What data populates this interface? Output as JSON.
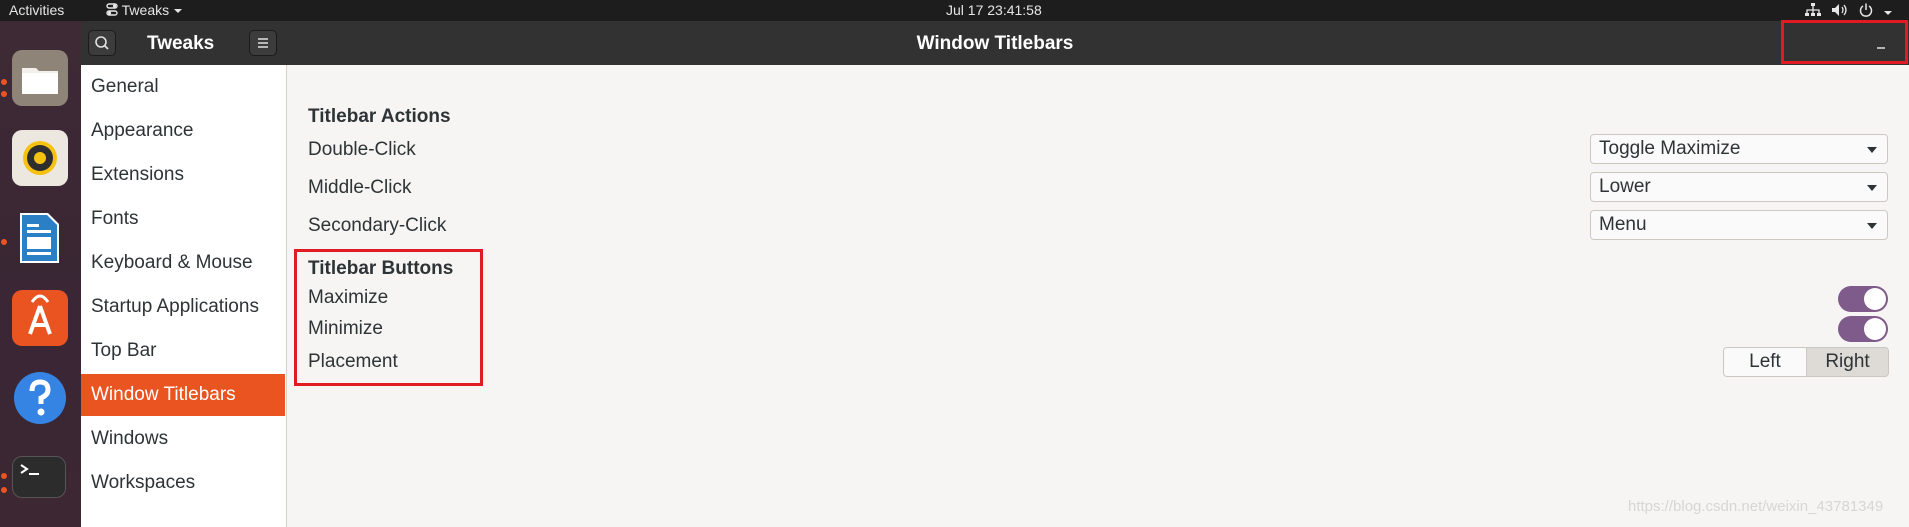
{
  "topbar": {
    "activities": "Activities",
    "app_menu": "Tweaks",
    "clock": "Jul 17  23:41:58"
  },
  "headerbar": {
    "app_title": "Tweaks",
    "window_title": "Window Titlebars"
  },
  "sidebar": {
    "items": [
      {
        "label": "General"
      },
      {
        "label": "Appearance"
      },
      {
        "label": "Extensions"
      },
      {
        "label": "Fonts"
      },
      {
        "label": "Keyboard & Mouse"
      },
      {
        "label": "Startup Applications"
      },
      {
        "label": "Top Bar"
      },
      {
        "label": "Window Titlebars",
        "selected": true
      },
      {
        "label": "Windows"
      },
      {
        "label": "Workspaces"
      }
    ]
  },
  "titlebar_actions": {
    "heading": "Titlebar Actions",
    "double_click": {
      "label": "Double-Click",
      "value": "Toggle Maximize"
    },
    "middle_click": {
      "label": "Middle-Click",
      "value": "Lower"
    },
    "secondary_click": {
      "label": "Secondary-Click",
      "value": "Menu"
    }
  },
  "titlebar_buttons": {
    "heading": "Titlebar Buttons",
    "maximize": {
      "label": "Maximize",
      "enabled": true
    },
    "minimize": {
      "label": "Minimize",
      "enabled": true
    },
    "placement": {
      "label": "Placement",
      "options": [
        "Left",
        "Right"
      ],
      "selected": "Right"
    }
  },
  "watermark": "https://blog.csdn.net/weixin_43781349",
  "colors": {
    "accent": "#e95420",
    "toggle_on": "#7e5b8a",
    "highlight": "#e01b24"
  }
}
